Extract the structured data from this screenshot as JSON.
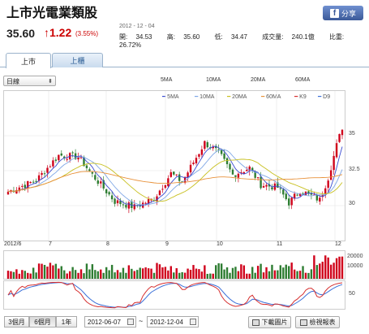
{
  "header": {
    "title": "上市光電業類股",
    "share_label": "分享",
    "share_icon_glyph": "f"
  },
  "quote": {
    "price": "35.60",
    "arrow": "↑",
    "change": "1.22",
    "change_pct": "(3.55%)",
    "date": "2012 - 12 - 04",
    "open_label": "開:",
    "open": "34.53",
    "high_label": "高:",
    "high": "35.60",
    "low_label": "低:",
    "low": "34.47",
    "volume_label": "成交量:",
    "volume": "240.1億",
    "ratio_label": "比重:",
    "ratio": "26.72%"
  },
  "tabs": [
    {
      "label": "上市"
    },
    {
      "label": "上櫃"
    }
  ],
  "controls": {
    "period_select": "日線",
    "ma_links": [
      "5MA",
      "10MA",
      "20MA",
      "60MA"
    ]
  },
  "legend": [
    "5MA",
    "10MA",
    "20MA",
    "60MA",
    "K9",
    "D9"
  ],
  "colors": {
    "up": "#d0021b",
    "down": "#2e7d32",
    "ma5": "#3a4bd1",
    "ma10": "#7fa7e6",
    "ma20": "#c8c020",
    "ma60": "#e8913a",
    "k9": "#d63030",
    "d9": "#3a6fd8"
  },
  "axis": {
    "price_ticks": [
      "35",
      "32.5",
      "30"
    ],
    "x_labels": [
      "2012/6",
      "7",
      "8",
      "9",
      "10",
      "11",
      "12"
    ],
    "volume_ticks": [
      "20000",
      "10000"
    ],
    "kd_tick": "50"
  },
  "footer": {
    "ranges": [
      "3個月",
      "6個月",
      "1年"
    ],
    "start_date": "2012-06-07",
    "separator": "~",
    "end_date": "2012-12-04",
    "download_label": "下載圖片",
    "report_label": "檢視報表"
  }
}
